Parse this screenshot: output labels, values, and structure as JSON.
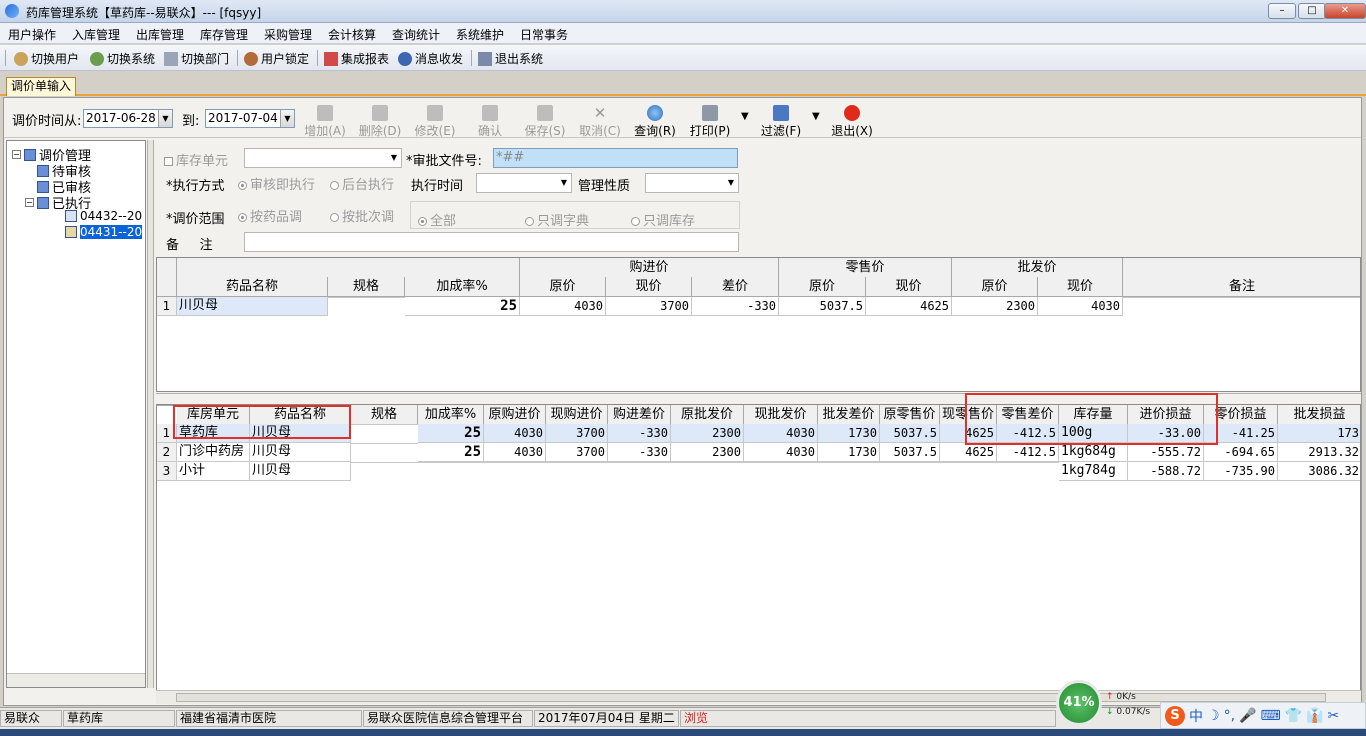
{
  "window": {
    "title": "药库管理系统【草药库--易联众】--- [fqsyy]",
    "controls": [
      "–",
      "□",
      "✕"
    ]
  },
  "menu": [
    "用户操作",
    "入库管理",
    "出库管理",
    "库存管理",
    "采购管理",
    "会计核算",
    "查询统计",
    "系统维护",
    "日常事务"
  ],
  "toolbar": [
    "切换用户",
    "切换系统",
    "切换部门",
    "用户锁定",
    "集成报表",
    "消息收发",
    "退出系统"
  ],
  "tab": "调价单输入",
  "filter": {
    "from_label": "调价时间从:",
    "from_value": "2017-06-28",
    "to_label": "到:",
    "to_value": "2017-07-04"
  },
  "actions": [
    {
      "label": "增加(A)",
      "enabled": false
    },
    {
      "label": "删除(D)",
      "enabled": false
    },
    {
      "label": "修改(E)",
      "enabled": false
    },
    {
      "label": "确认",
      "enabled": false
    },
    {
      "label": "保存(S)",
      "enabled": false
    },
    {
      "label": "取消(C)",
      "enabled": false
    },
    {
      "label": "查询(R)",
      "enabled": true
    },
    {
      "label": "打印(P)",
      "enabled": true
    },
    {
      "label": "过滤(F)",
      "enabled": true
    },
    {
      "label": "退出(X)",
      "enabled": true
    }
  ],
  "tree": {
    "root": "调价管理",
    "children": [
      "待审核",
      "已审核",
      "已执行"
    ],
    "leaves": [
      "04432--20",
      "04431--20"
    ]
  },
  "form": {
    "storage_unit": "库存单元",
    "approval_label": "*审批文件号:",
    "approval_value": "*##",
    "exec_mode_label": "*执行方式",
    "exec_opt1": "审核即执行",
    "exec_opt2": "后台执行",
    "exec_time_label": "执行时间",
    "mgmt_label": "管理性质",
    "scope_label": "*调价范围",
    "scope_opt1": "按药品调",
    "scope_opt2": "按批次调",
    "range_opt1": "全部",
    "range_opt2": "只调字典",
    "range_opt3": "只调库存",
    "remark_label": "备     注"
  },
  "grid1": {
    "group_headers": [
      "购进价",
      "零售价",
      "批发价"
    ],
    "headers": [
      "药品名称",
      "规格",
      "加成率%",
      "原价",
      "现价",
      "差价",
      "原价",
      "现价",
      "原价",
      "现价",
      "备注"
    ],
    "rows": [
      [
        "1",
        "川贝母",
        "",
        "25",
        "4030",
        "3700",
        "-330",
        "5037.5",
        "4625",
        "2300",
        "4030",
        ""
      ]
    ]
  },
  "grid2": {
    "headers": [
      "库房单元",
      "药品名称",
      "规格",
      "加成率%",
      "原购进价",
      "现购进价",
      "购进差价",
      "原批发价",
      "现批发价",
      "批发差价",
      "原零售价",
      "现零售价",
      "零售差价",
      "库存量",
      "进价损益",
      "零价损益",
      "批发损益"
    ],
    "rows": [
      [
        "1",
        "草药库",
        "川贝母",
        "",
        "25",
        "4030",
        "3700",
        "-330",
        "2300",
        "4030",
        "1730",
        "5037.5",
        "4625",
        "-412.5",
        "100g",
        "-33.00",
        "-41.25",
        "173"
      ],
      [
        "2",
        "门诊中药房",
        "川贝母",
        "",
        "25",
        "4030",
        "3700",
        "-330",
        "2300",
        "4030",
        "1730",
        "5037.5",
        "4625",
        "-412.5",
        "1kg684g",
        "-555.72",
        "-694.65",
        "2913.32"
      ],
      [
        "3",
        "小计",
        "川贝母",
        "",
        "",
        "",
        "",
        "",
        "",
        "",
        "",
        "",
        "",
        "",
        "1kg784g",
        "-588.72",
        "-735.90",
        "3086.32"
      ]
    ]
  },
  "status": {
    "user": "易联众",
    "dept": "草药库",
    "hospital": "福建省福清市医院",
    "platform": "易联众医院信息综合管理平台",
    "date": "2017年07月04日 星期二",
    "mode": "浏览",
    "mode_color": "#d42020"
  },
  "net": {
    "percent": "41%",
    "up": "0K/s",
    "down": "0.07K/s"
  },
  "ime": {
    "brand": "S",
    "chars": [
      "中",
      "☽",
      "°,",
      "🎤",
      "⌨",
      "👕",
      "👔",
      "✂"
    ]
  }
}
